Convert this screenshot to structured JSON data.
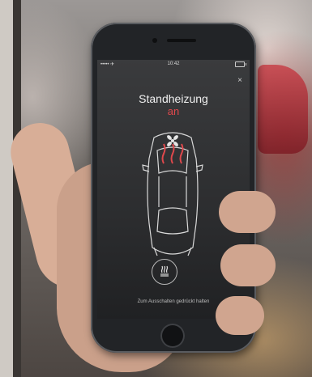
{
  "statusbar": {
    "carrier": "••••• ✈",
    "time": "10:42"
  },
  "header": {
    "close_label": "×"
  },
  "main": {
    "title": "Standheizung",
    "status": "an",
    "hint": "Zum Ausschalten gedrückt halten"
  },
  "colors": {
    "accent": "#e0484c",
    "screen_bg": "#2c2d2f",
    "text": "#f1f1f1"
  },
  "icons": {
    "close": "close-icon",
    "heater": "heater-icon",
    "car": "car-topview-icon",
    "fan": "fan-icon"
  }
}
